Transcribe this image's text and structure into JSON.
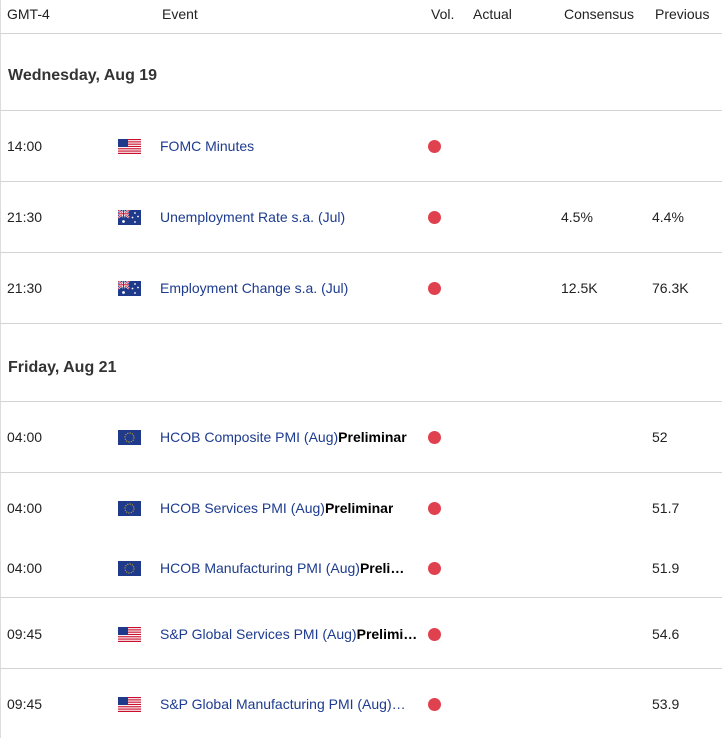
{
  "header": {
    "timezone": "GMT-4",
    "event": "Event",
    "vol": "Vol.",
    "actual": "Actual",
    "consensus": "Consensus",
    "previous": "Previous"
  },
  "days": [
    {
      "label": "Wednesday, Aug 19",
      "events": [
        {
          "time": "14:00",
          "flag": "us-flag-icon",
          "name": "FOMC Minutes",
          "suffix": "",
          "consensus": "",
          "previous": ""
        },
        {
          "time": "21:30",
          "flag": "au-flag-icon",
          "name": "Unemployment Rate s.a. (Jul)",
          "suffix": "",
          "consensus": "4.5%",
          "previous": "4.4%"
        },
        {
          "time": "21:30",
          "flag": "au-flag-icon",
          "name": "Employment Change s.a. (Jul)",
          "suffix": "",
          "consensus": "12.5K",
          "previous": "76.3K"
        }
      ]
    },
    {
      "label": "Friday, Aug 21",
      "events": [
        {
          "time": "04:00",
          "flag": "eu-flag-icon",
          "name": "HCOB Composite PMI (Aug)",
          "suffix": "Preliminar",
          "consensus": "",
          "previous": "52"
        },
        {
          "time": "04:00",
          "flag": "eu-flag-icon",
          "name": "HCOB Services PMI (Aug)",
          "suffix": "Preliminar",
          "consensus": "",
          "previous": "51.7"
        },
        {
          "time": "04:00",
          "flag": "eu-flag-icon",
          "name": "HCOB Manufacturing PMI (Aug)",
          "suffix": "Preli…",
          "consensus": "",
          "previous": "51.9"
        },
        {
          "time": "09:45",
          "flag": "us-flag-icon",
          "name": "S&P Global Services PMI (Aug)",
          "suffix": "Prelimi…",
          "consensus": "",
          "previous": "54.6"
        },
        {
          "time": "09:45",
          "flag": "us-flag-icon",
          "name": "S&P Global Manufacturing PMI (Aug)…",
          "suffix": "",
          "consensus": "",
          "previous": "53.9"
        }
      ]
    }
  ],
  "colors": {
    "event_text": "#1d3b8f",
    "volatility_dot": "#e0414f",
    "divider": "#d4d4d4"
  }
}
